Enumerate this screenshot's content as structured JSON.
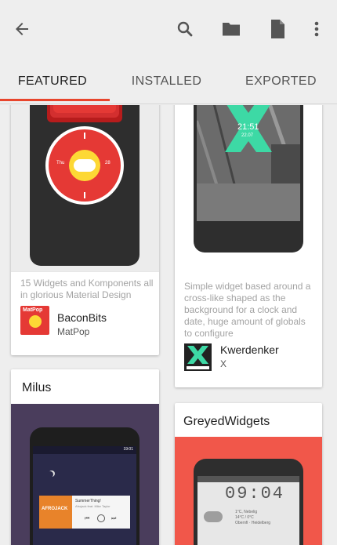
{
  "toolbar": {
    "back_icon": "arrow-back-icon",
    "search_icon": "search-icon",
    "folder_icon": "folder-icon",
    "file_icon": "file-icon",
    "more_icon": "more-vert-icon"
  },
  "tabs": [
    {
      "label": "FEATURED",
      "active": true
    },
    {
      "label": "INSTALLED",
      "active": false
    },
    {
      "label": "EXPORTED",
      "active": false
    }
  ],
  "colors": {
    "accent": "#e8452c",
    "kwerdenker": "#3dd9a5",
    "milus_bg": "#4a3d5c",
    "greyed_bg": "#f1574a"
  },
  "cards": [
    {
      "description": "15 Widgets and Komponents all in glorious Material Design",
      "app_name": "BaconBits",
      "author": "MatPop",
      "icon_text": "MatPop",
      "preview": {
        "clock_left": "Thu",
        "clock_right": "28"
      }
    },
    {
      "description": "Simple widget based around a cross-like shaped as the background for a clock and date, huge amount of globals to configure",
      "app_name": "Kwerdenker",
      "author": "X",
      "preview": {
        "time": "21:51",
        "date": "22.07"
      }
    },
    {
      "title": "Milus",
      "preview": {
        "status_time": "19:01",
        "song": "SummerThing!",
        "artist": "Afrojack feat. Mike Taylor",
        "album_text": "AFROJACK"
      }
    },
    {
      "title": "GreyedWidgets",
      "preview": {
        "clock": "09:04",
        "weather_temp": "1°C, Nebelig",
        "weather_detail": "14°C / 0°C",
        "location": "Obernfi · Heidelberg"
      }
    }
  ]
}
